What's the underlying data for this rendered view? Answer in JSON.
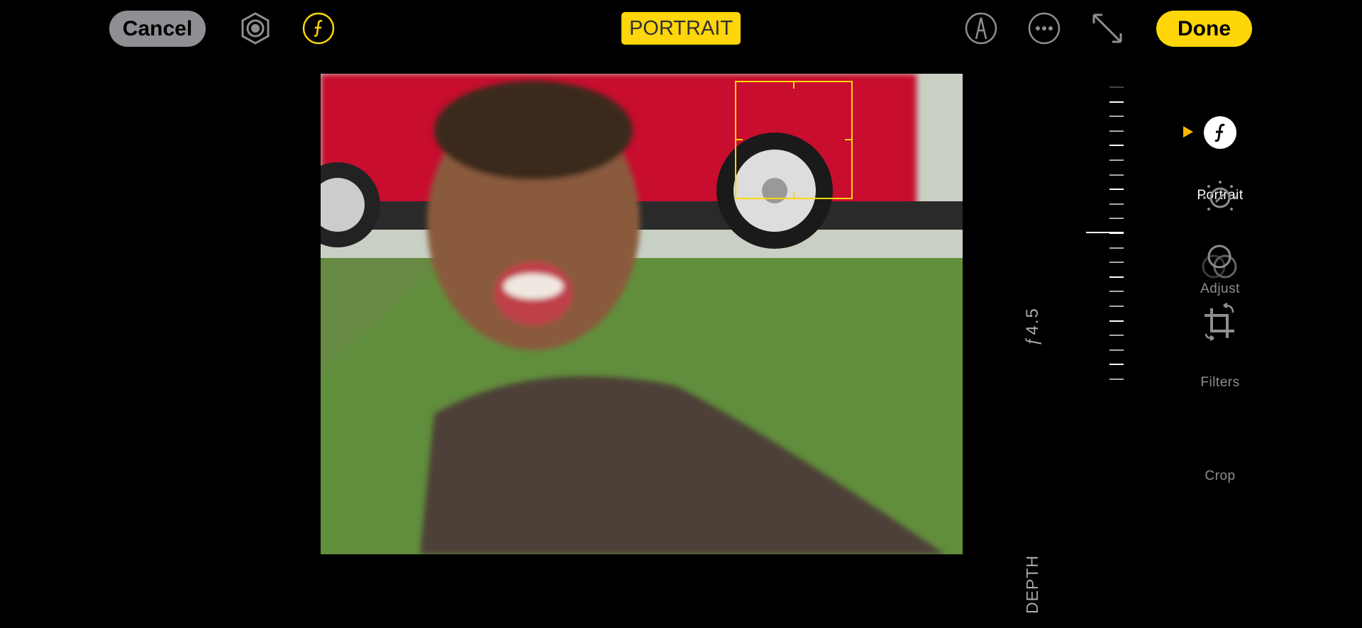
{
  "toolbar": {
    "cancel": "Cancel",
    "mode": "PORTRAIT",
    "done": "Done"
  },
  "icons": [
    "live-photo-icon",
    "aperture-f-icon",
    "markup-icon",
    "more-icon",
    "expand-icon"
  ],
  "slider": {
    "value": "ƒ4.5",
    "label": "DEPTH"
  },
  "tools": [
    {
      "label": "Portrait",
      "icon": "portrait-f-icon",
      "selected": true
    },
    {
      "label": "Adjust",
      "icon": "adjust-dial-icon"
    },
    {
      "label": "Filters",
      "icon": "filters-icon"
    },
    {
      "label": "Crop",
      "icon": "crop-rotate-icon"
    }
  ],
  "colors": {
    "accent": "#ffd60a",
    "cancel_bg": "#8e8e93",
    "inactive": "#8e8e93"
  }
}
